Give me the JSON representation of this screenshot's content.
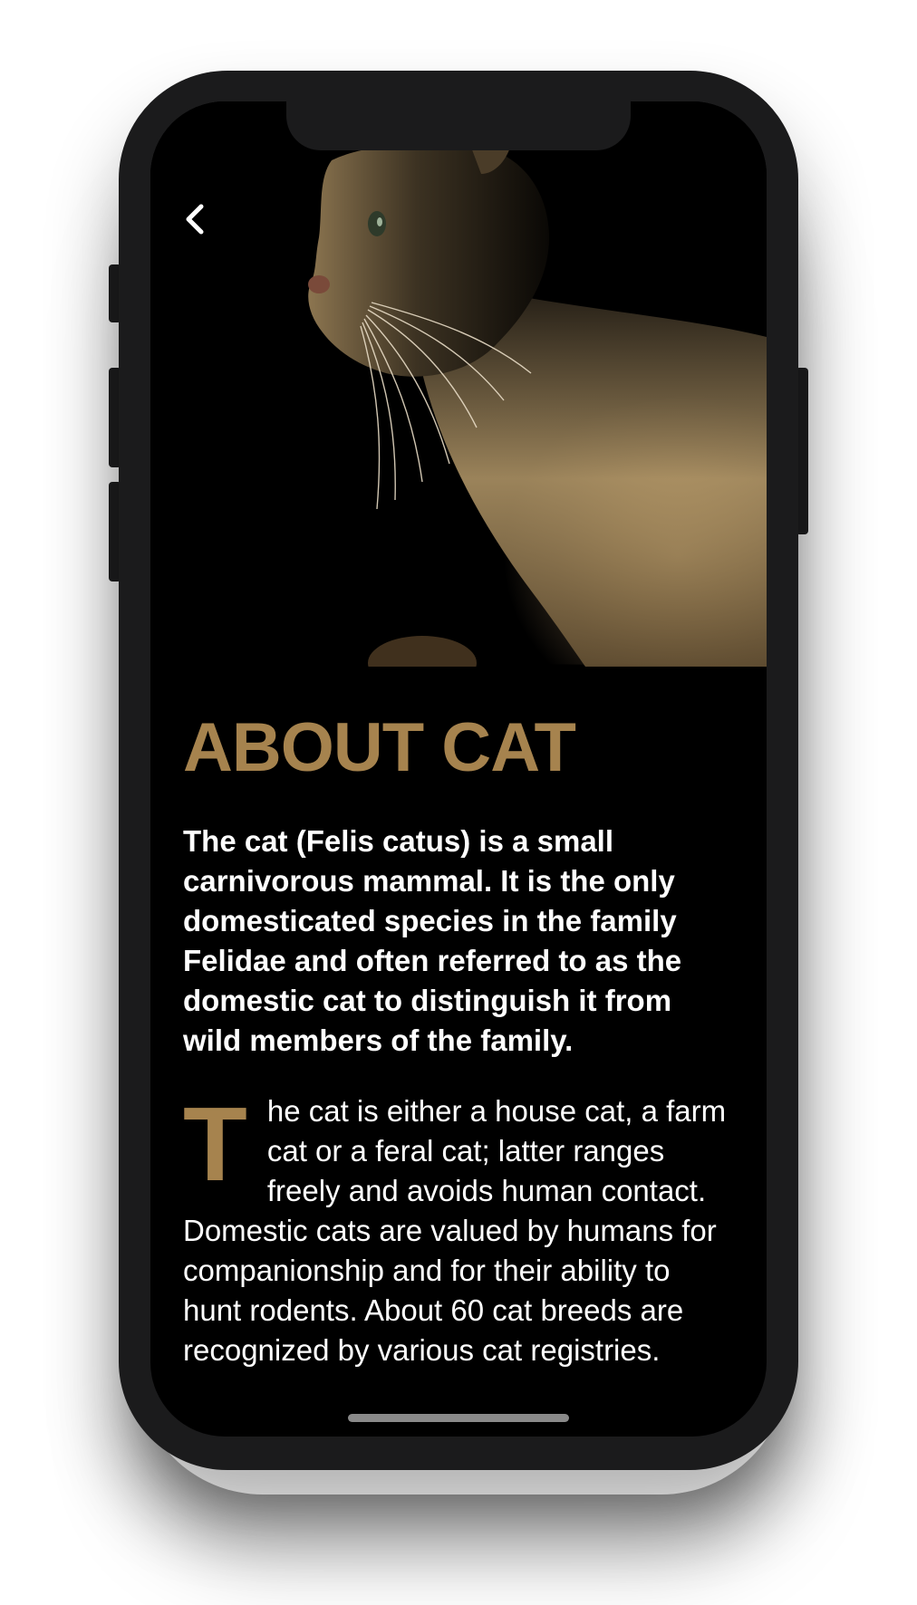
{
  "screen": {
    "back_icon": "chevron-left-icon",
    "hero_image": "cat-profile-photo",
    "title": "ABOUT CAT",
    "intro": "The cat (Felis catus) is a small carnivorous mammal. It is the only domesticated species in the family Felidae and often referred to as the domestic cat to distinguish it from wild members of the family.",
    "body_dropcap": "T",
    "body_rest": "he cat is either a house cat, a farm cat or a feral cat; latter ranges freely and avoids human contact. Domestic cats are valued by humans for companionship and for their ability to hunt rodents. About 60 cat breeds are recognized by various cat registries."
  },
  "colors": {
    "accent": "#a6834e",
    "background": "#000000",
    "text": "#ffffff",
    "device": "#1b1b1c"
  }
}
